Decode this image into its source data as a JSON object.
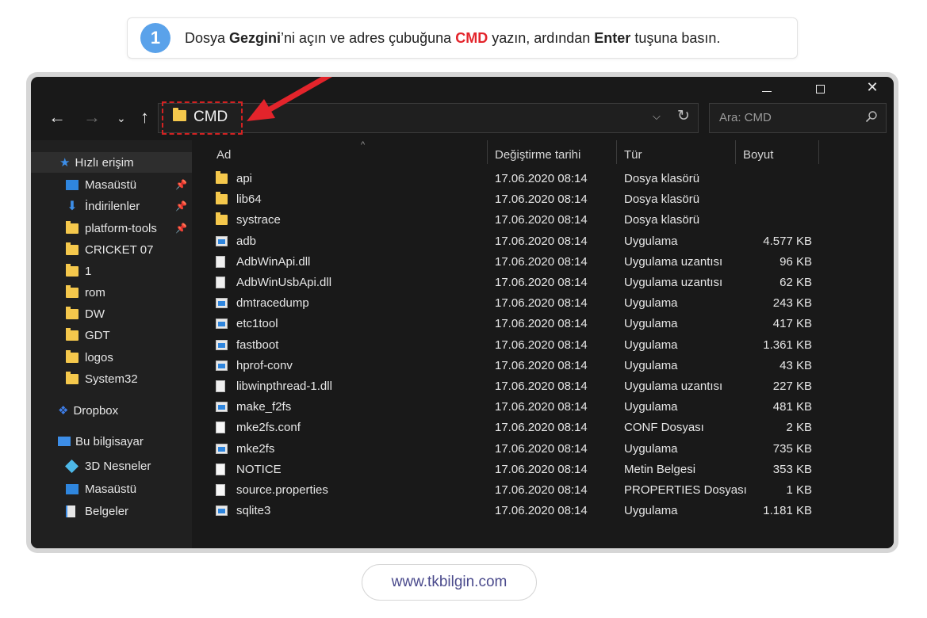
{
  "instruction": {
    "step": "1",
    "part1": "Dosya ",
    "part2": "Gezgini",
    "part3": "’ni açın ve adres çubuğuna ",
    "part4": "CMD",
    "part5": " yazın, ardından ",
    "part6": "Enter",
    "part7": " tuşuna basın."
  },
  "window": {
    "address_value": "CMD",
    "search_placeholder": "Ara: CMD"
  },
  "sidebar": {
    "items": [
      {
        "label": "Hızlı erişim",
        "icon": "star-icon"
      },
      {
        "label": "Masaüstü",
        "icon": "desktop-icon",
        "pinned": true
      },
      {
        "label": "İndirilenler",
        "icon": "download-icon",
        "pinned": true
      },
      {
        "label": "platform-tools",
        "icon": "folder-icon",
        "pinned": true
      },
      {
        "label": "CRICKET 07",
        "icon": "folder-icon"
      },
      {
        "label": "1",
        "icon": "folder-icon"
      },
      {
        "label": "rom",
        "icon": "folder-icon"
      },
      {
        "label": "DW",
        "icon": "folder-icon"
      },
      {
        "label": "GDT",
        "icon": "folder-icon"
      },
      {
        "label": "logos",
        "icon": "folder-icon"
      },
      {
        "label": "System32",
        "icon": "folder-icon"
      },
      {
        "label": "Dropbox",
        "icon": "dropbox-icon"
      },
      {
        "label": "Bu bilgisayar",
        "icon": "computer-icon"
      },
      {
        "label": "3D Nesneler",
        "icon": "cube-icon"
      },
      {
        "label": "Masaüstü",
        "icon": "desktop-icon"
      },
      {
        "label": "Belgeler",
        "icon": "documents-icon"
      }
    ]
  },
  "columns": {
    "name": "Ad",
    "date": "Değiştirme tarihi",
    "type": "Tür",
    "size": "Boyut"
  },
  "files": [
    {
      "name": "api",
      "date": "17.06.2020 08:14",
      "type": "Dosya klasörü",
      "size": "",
      "kind": "folder"
    },
    {
      "name": "lib64",
      "date": "17.06.2020 08:14",
      "type": "Dosya klasörü",
      "size": "",
      "kind": "folder"
    },
    {
      "name": "systrace",
      "date": "17.06.2020 08:14",
      "type": "Dosya klasörü",
      "size": "",
      "kind": "folder"
    },
    {
      "name": "adb",
      "date": "17.06.2020 08:14",
      "type": "Uygulama",
      "size": "4.577 KB",
      "kind": "app"
    },
    {
      "name": "AdbWinApi.dll",
      "date": "17.06.2020 08:14",
      "type": "Uygulama uzantısı",
      "size": "96 KB",
      "kind": "dll"
    },
    {
      "name": "AdbWinUsbApi.dll",
      "date": "17.06.2020 08:14",
      "type": "Uygulama uzantısı",
      "size": "62 KB",
      "kind": "dll"
    },
    {
      "name": "dmtracedump",
      "date": "17.06.2020 08:14",
      "type": "Uygulama",
      "size": "243 KB",
      "kind": "app"
    },
    {
      "name": "etc1tool",
      "date": "17.06.2020 08:14",
      "type": "Uygulama",
      "size": "417 KB",
      "kind": "app"
    },
    {
      "name": "fastboot",
      "date": "17.06.2020 08:14",
      "type": "Uygulama",
      "size": "1.361 KB",
      "kind": "app"
    },
    {
      "name": "hprof-conv",
      "date": "17.06.2020 08:14",
      "type": "Uygulama",
      "size": "43 KB",
      "kind": "app"
    },
    {
      "name": "libwinpthread-1.dll",
      "date": "17.06.2020 08:14",
      "type": "Uygulama uzantısı",
      "size": "227 KB",
      "kind": "dll"
    },
    {
      "name": "make_f2fs",
      "date": "17.06.2020 08:14",
      "type": "Uygulama",
      "size": "481 KB",
      "kind": "app"
    },
    {
      "name": "mke2fs.conf",
      "date": "17.06.2020 08:14",
      "type": "CONF Dosyası",
      "size": "2 KB",
      "kind": "file"
    },
    {
      "name": "mke2fs",
      "date": "17.06.2020 08:14",
      "type": "Uygulama",
      "size": "735 KB",
      "kind": "app"
    },
    {
      "name": "NOTICE",
      "date": "17.06.2020 08:14",
      "type": "Metin Belgesi",
      "size": "353 KB",
      "kind": "file"
    },
    {
      "name": "source.properties",
      "date": "17.06.2020 08:14",
      "type": "PROPERTIES Dosyası",
      "size": "1 KB",
      "kind": "file"
    },
    {
      "name": "sqlite3",
      "date": "17.06.2020 08:14",
      "type": "Uygulama",
      "size": "1.181 KB",
      "kind": "app"
    }
  ],
  "footer": {
    "url": "www.tkbilgin.com"
  }
}
